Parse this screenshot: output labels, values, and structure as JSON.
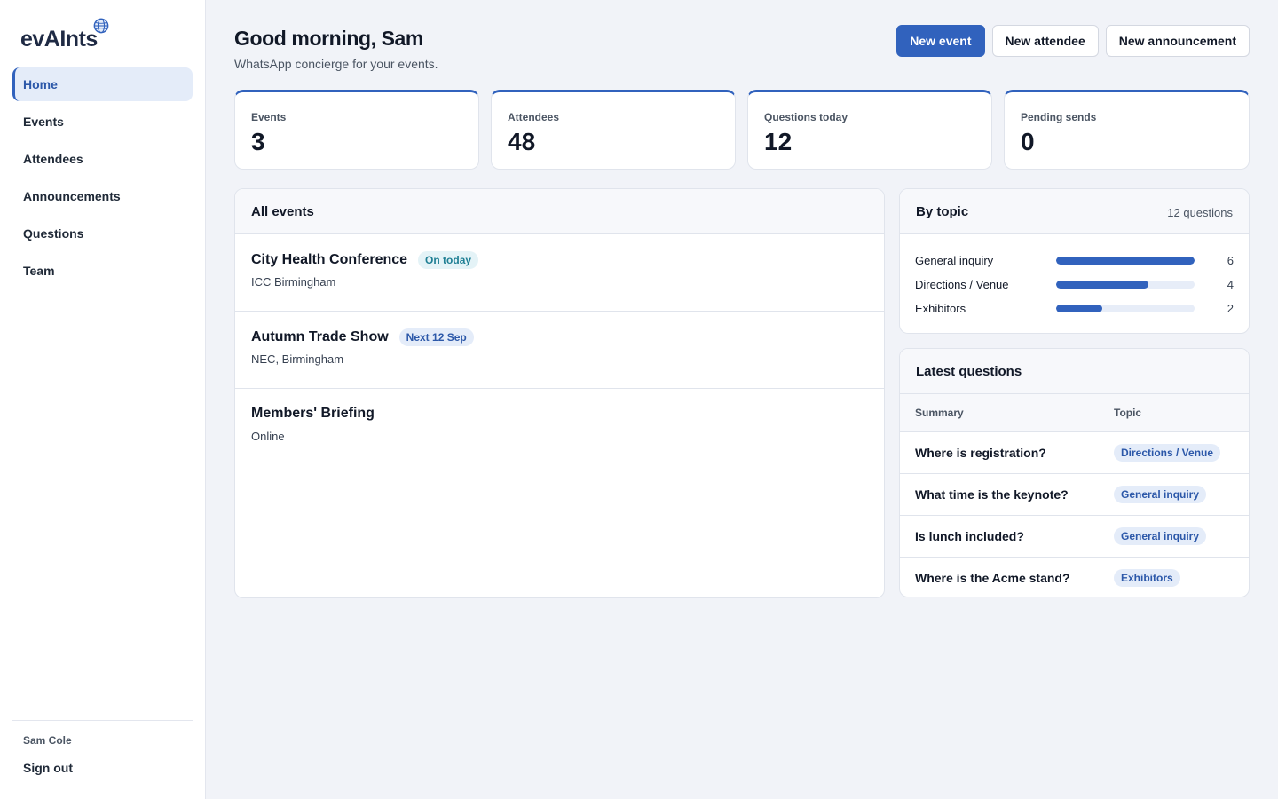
{
  "brand": {
    "name": "evAInts",
    "logo_icon": "globe-icon"
  },
  "sidebar": {
    "items": [
      {
        "label": "Home",
        "active": true
      },
      {
        "label": "Events",
        "active": false
      },
      {
        "label": "Attendees",
        "active": false
      },
      {
        "label": "Announcements",
        "active": false
      },
      {
        "label": "Questions",
        "active": false
      },
      {
        "label": "Team",
        "active": false
      }
    ],
    "user_name": "Sam Cole",
    "sign_out_label": "Sign out"
  },
  "header": {
    "greeting": "Good morning, Sam",
    "subtitle": "WhatsApp concierge for your events.",
    "buttons": {
      "new_event": "New event",
      "new_attendee": "New attendee",
      "new_announcement": "New announcement"
    }
  },
  "stats": [
    {
      "label": "Events",
      "value": "3"
    },
    {
      "label": "Attendees",
      "value": "48"
    },
    {
      "label": "Questions today",
      "value": "12"
    },
    {
      "label": "Pending sends",
      "value": "0"
    }
  ],
  "events_panel": {
    "title": "All events",
    "events": [
      {
        "name": "City Health Conference",
        "badge": "On today",
        "venue": "ICC Birmingham"
      },
      {
        "name": "Autumn Trade Show",
        "badge": "Next 12 Sep",
        "venue": "NEC, Birmingham"
      },
      {
        "name": "Members' Briefing",
        "badge": "",
        "venue": "Online"
      }
    ]
  },
  "topic_panel": {
    "title": "By topic",
    "total_label": "12 questions",
    "max_count": 6,
    "topics": [
      {
        "label": "General inquiry",
        "count": 6
      },
      {
        "label": "Directions / Venue",
        "count": 4
      },
      {
        "label": "Exhibitors",
        "count": 2
      }
    ]
  },
  "questions_panel": {
    "title": "Latest questions",
    "columns": {
      "summary": "Summary",
      "topic": "Topic"
    },
    "rows": [
      {
        "summary": "Where is registration?",
        "topic": "Directions / Venue"
      },
      {
        "summary": "What time is the keynote?",
        "topic": "General inquiry"
      },
      {
        "summary": "Is lunch included?",
        "topic": "General inquiry"
      },
      {
        "summary": "Where is the Acme stand?",
        "topic": "Exhibitors"
      }
    ]
  },
  "colors": {
    "accent": "#3162bd",
    "background": "#f1f3f8",
    "badge_today_bg": "#e4f3f7",
    "badge_today_text": "#1f7f94",
    "badge_blue_bg": "#e4ecf9",
    "badge_blue_text": "#2c58a9"
  }
}
